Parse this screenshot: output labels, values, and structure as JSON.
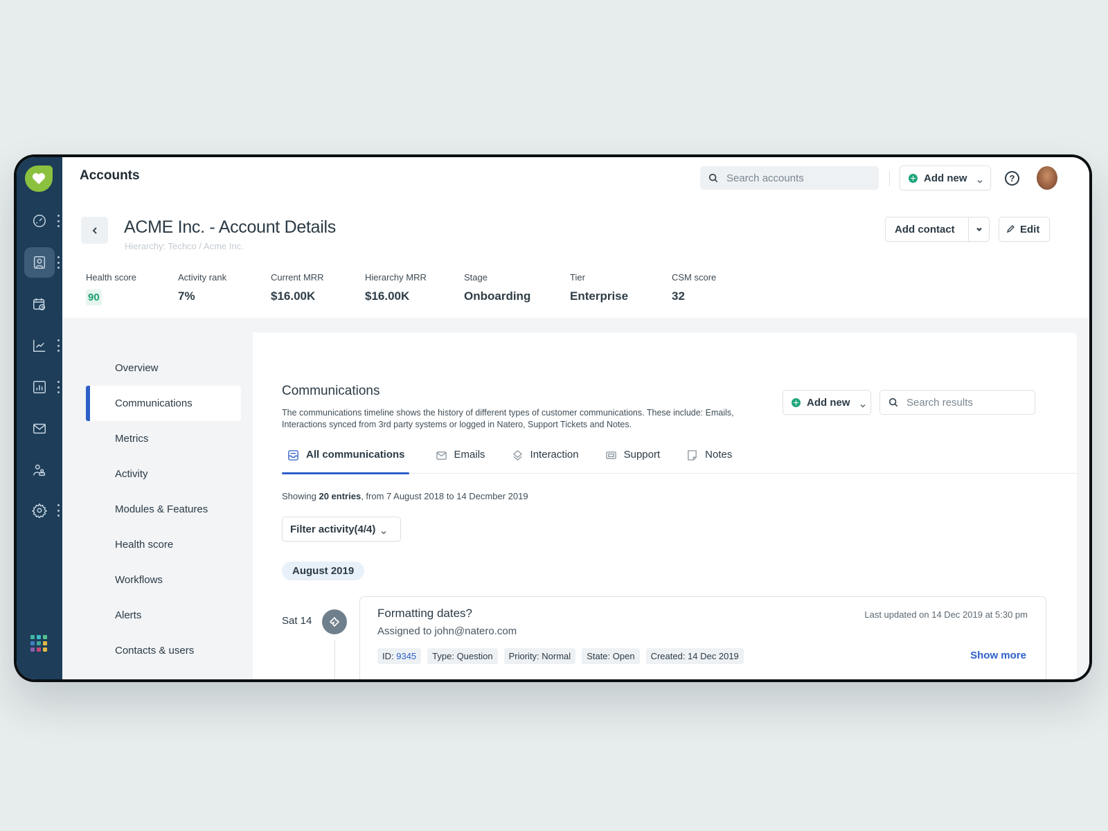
{
  "app": {
    "title": "Accounts"
  },
  "header": {
    "search_placeholder": "Search accounts",
    "add_new_label": "Add new",
    "help_icon": "question-circle-icon",
    "avatar": "user-avatar"
  },
  "account": {
    "title": "ACME Inc. - Account Details",
    "hierarchy": "Hierarchy: Techco / Acme Inc.",
    "add_contact_label": "Add contact",
    "edit_label": "Edit"
  },
  "stats": [
    {
      "label": "Health score",
      "value": "90"
    },
    {
      "label": "Activity rank",
      "value": "7%"
    },
    {
      "label": "Current MRR",
      "value": "$16.00K"
    },
    {
      "label": "Hierarchy MRR",
      "value": "$16.00K"
    },
    {
      "label": "Stage",
      "value": "Onboarding"
    },
    {
      "label": "Tier",
      "value": "Enterprise"
    },
    {
      "label": "CSM score",
      "value": "32"
    }
  ],
  "rail": {
    "items": [
      "dashboard-icon",
      "accounts-icon",
      "calendar-clock-icon",
      "trend-chart-icon",
      "bar-chart-icon",
      "mail-icon",
      "users-icon",
      "settings-icon"
    ],
    "apps_colors": [
      "#3fb6a0",
      "#3fb8c8",
      "#55c08f",
      "#3f7fc0",
      "#3fa69a",
      "#e0b94a",
      "#8a5fae",
      "#c04a7a",
      "#e0b94a"
    ],
    "brand_color": "#8cc13f"
  },
  "sidenav": {
    "items": [
      "Overview",
      "Communications",
      "Metrics",
      "Activity",
      "Modules & Features",
      "Health score",
      "Workflows",
      "Alerts",
      "Contacts & users"
    ],
    "active": "Communications"
  },
  "communications": {
    "title": "Communications",
    "description": "The communications timeline shows the history of different types of customer communications. These include: Emails, Interactions synced from 3rd party systems or logged in Natero, Support Tickets and Notes.",
    "add_new_label": "Add new",
    "search_placeholder": "Search results",
    "tabs": [
      "All communications",
      "Emails",
      "Interaction",
      "Support",
      "Notes"
    ],
    "active_tab": "All communications",
    "showing_prefix": "Showing ",
    "showing_count": "20 entries",
    "showing_suffix": ", from 7 August 2018 to 14 Decmber 2019",
    "filter_label": "Filter activity(4/4)",
    "month": "August 2019",
    "entries": [
      {
        "day": "Sat 14",
        "title": "Formatting dates?",
        "assigned": "Assigned to john@natero.com",
        "updated": "Last updated on 14 Dec 2019 at 5:30 pm",
        "id_label": "ID: ",
        "id": "9345",
        "type": "Type: Question",
        "priority": "Priority: Normal",
        "state": "State: Open",
        "created": "Created: 14 Dec 2019",
        "show_more": "Show more"
      }
    ]
  },
  "colors": {
    "accent": "#2d5fc7",
    "success": "#21a57d",
    "rail": "#1d3d58"
  }
}
